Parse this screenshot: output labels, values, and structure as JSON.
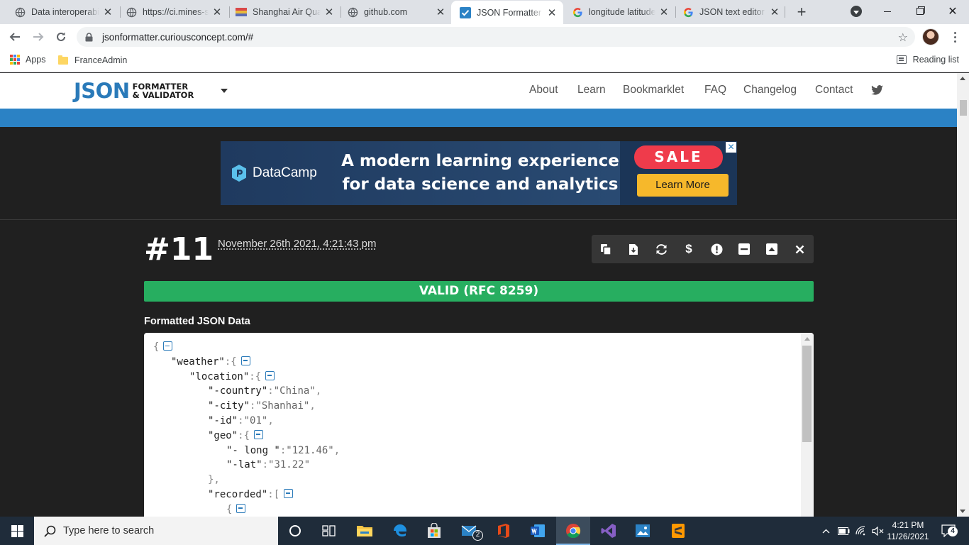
{
  "browser": {
    "tabs": [
      {
        "title": "Data interoperabilit",
        "icon": "globe-icon"
      },
      {
        "title": "https://ci.mines-stet",
        "icon": "globe-icon"
      },
      {
        "title": "Shanghai Air Quality",
        "icon": "flag-icon"
      },
      {
        "title": "github.com",
        "icon": "globe-icon"
      },
      {
        "title": "JSON Formatter & Validator",
        "icon": "check-favicon-icon"
      },
      {
        "title": "longitude latitude",
        "icon": "google-icon"
      },
      {
        "title": "JSON text editor",
        "icon": "google-icon"
      }
    ],
    "active_tab_index": 4,
    "url": "jsonformatter.curiousconcept.com/#",
    "bookmarks": [
      {
        "label": "Apps"
      },
      {
        "label": "FranceAdmin"
      }
    ],
    "reading_list_label": "Reading list"
  },
  "site": {
    "logo_big": "JSON",
    "logo_line1": "FORMATTER",
    "logo_line2": "& VALIDATOR",
    "nav": [
      "About",
      "Learn",
      "Bookmarklet",
      "FAQ",
      "Changelog",
      "Contact"
    ],
    "accent_color": "#2b82c5"
  },
  "ad": {
    "brand": "DataCamp",
    "headline_line1": "A modern learning experience",
    "headline_line2": "for data science and analytics",
    "sale_label": "SALE",
    "cta_label": "Learn More",
    "close_glyph": "✕"
  },
  "entry": {
    "number": "#11",
    "timestamp": "November 26th 2021, 4:21:43 pm",
    "tools": [
      "copy-icon",
      "download-icon",
      "refresh-icon",
      "dollar-icon",
      "alert-icon",
      "minimize-icon",
      "expand-icon",
      "close-icon"
    ],
    "status": "VALID (RFC 8259)",
    "status_color": "#27ae60",
    "section_title": "Formatted JSON Data"
  },
  "json_view": {
    "k_weather": "\"weather\"",
    "k_location": "\"location\"",
    "k_country": "\"-country\"",
    "v_country": "\"China\"",
    "k_city": "\"-city\"",
    "v_city": "\"Shanhai\"",
    "k_id": "\"-id\"",
    "v_id": "\"01\"",
    "k_geo": "\"geo\"",
    "k_long": "\"- long \"",
    "v_long": "\"121.46\"",
    "k_lat": "\"-lat\"",
    "v_lat": "\"31.22\"",
    "k_recorded": "\"recorded\""
  },
  "taskbar": {
    "search_placeholder": "Type here to search",
    "apps": [
      "cortana-icon",
      "task-view-icon",
      "file-explorer-icon",
      "edge-icon",
      "store-icon",
      "mail-icon",
      "office-icon",
      "word-icon",
      "chrome-icon",
      "visual-studio-icon",
      "photos-icon",
      "sublime-icon"
    ],
    "mail_badge": "2",
    "time": "4:21 PM",
    "date": "11/26/2021",
    "notification_count": "4"
  }
}
